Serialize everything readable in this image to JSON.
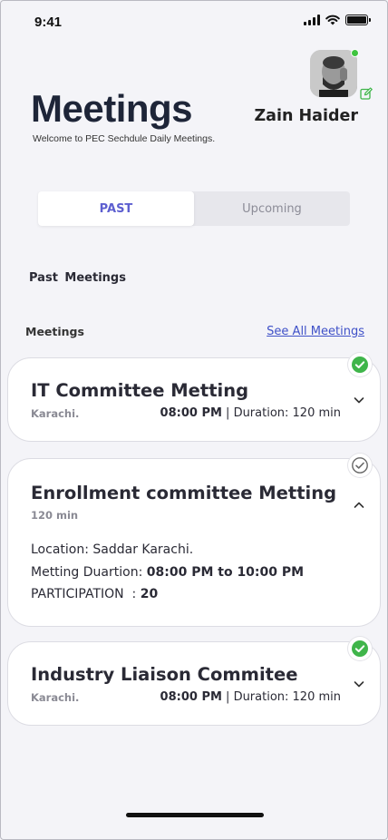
{
  "status_bar": {
    "time": "9:41"
  },
  "header": {
    "title": "Meetings",
    "subtitle": "Welcome to PEC Sechdule Daily Meetings.",
    "user_name": "Zain Haider",
    "online_color": "#3fc43f"
  },
  "tabs": [
    {
      "label": "PAST",
      "active": true
    },
    {
      "label": "Upcoming",
      "active": false
    }
  ],
  "section_title": "Past Meetings",
  "list": {
    "label": "Meetings",
    "see_all": "See All Meetings"
  },
  "meetings": [
    {
      "title": "IT Committee Metting",
      "place": "Karachi.",
      "time": "08:00 PM",
      "separator": " | ",
      "duration": "Duration: 120 min",
      "status_icon": "check-filled-green",
      "expanded": false
    },
    {
      "title": "Enrollment committee Metting",
      "subtitle": "120 min",
      "status_icon": "check-outline-gray",
      "expanded": true,
      "details": {
        "location": "Location: Saddar Karachi.",
        "duration_label": "Metting Duartion: ",
        "duration_value": "08:00 PM to 10:00 PM",
        "participation_label": "PARTICIPATION  : ",
        "participation_value": "20"
      }
    },
    {
      "title": "Industry Liaison Commitee",
      "place": "Karachi.",
      "time": "08:00 PM",
      "separator": " | ",
      "duration": "Duration: 120 min",
      "status_icon": "check-filled-green",
      "expanded": false
    }
  ],
  "colors": {
    "accent": "#5d5fd0",
    "link": "#3f51c8",
    "success": "#3fc43f",
    "background": "#f4f4f8"
  }
}
